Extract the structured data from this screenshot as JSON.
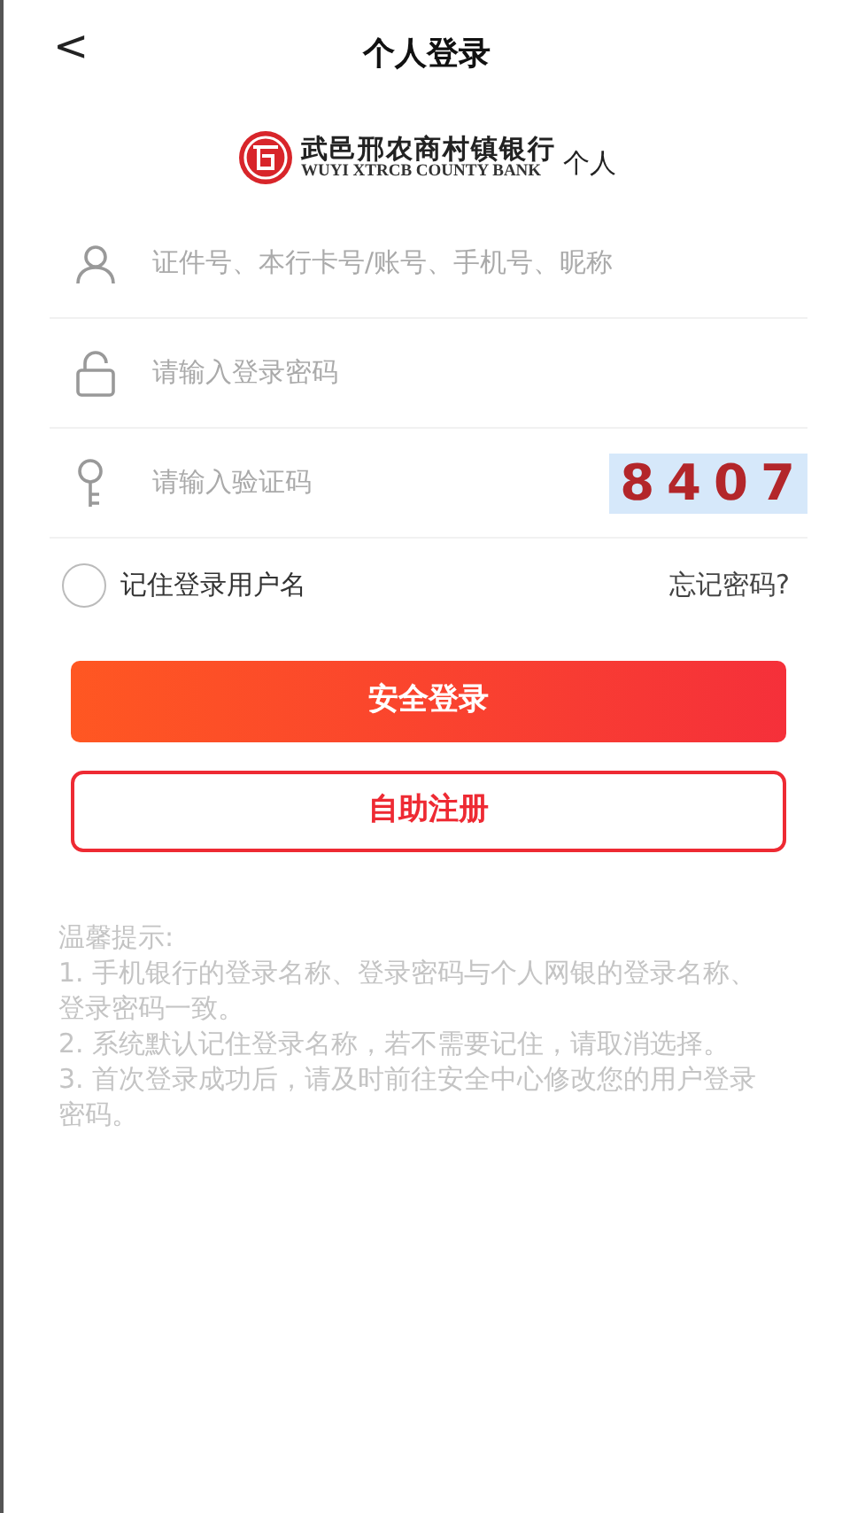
{
  "header": {
    "back": "<",
    "title": "个人登录"
  },
  "logo": {
    "name_cn": "武邑邢农商村镇银行",
    "name_en": "WUYI XTRCB COUNTY BANK",
    "suffix": "个人"
  },
  "fields": [
    {
      "kind": "user",
      "placeholder": "证件号、本行卡号/账号、手机号、昵称"
    },
    {
      "kind": "password",
      "placeholder": "请输入登录密码"
    },
    {
      "kind": "captcha",
      "placeholder": "请输入验证码",
      "captcha": "8407"
    }
  ],
  "remember": {
    "label": "记住登录用户名",
    "checked": false
  },
  "forgot": "忘记密码?",
  "buttons": [
    {
      "kind": "primary",
      "label": "安全登录"
    },
    {
      "kind": "outline",
      "label": "自助注册"
    }
  ],
  "tips": {
    "title": "温馨提示:",
    "items": [
      "1. 手机银行的登录名称、登录密码与个人网银的登录名称、登录密码一致。",
      "2. 系统默认记住登录名称，若不需要记住，请取消选择。",
      "3. 首次登录成功后，请及时前往安全中心修改您的用户登录密码。"
    ]
  }
}
